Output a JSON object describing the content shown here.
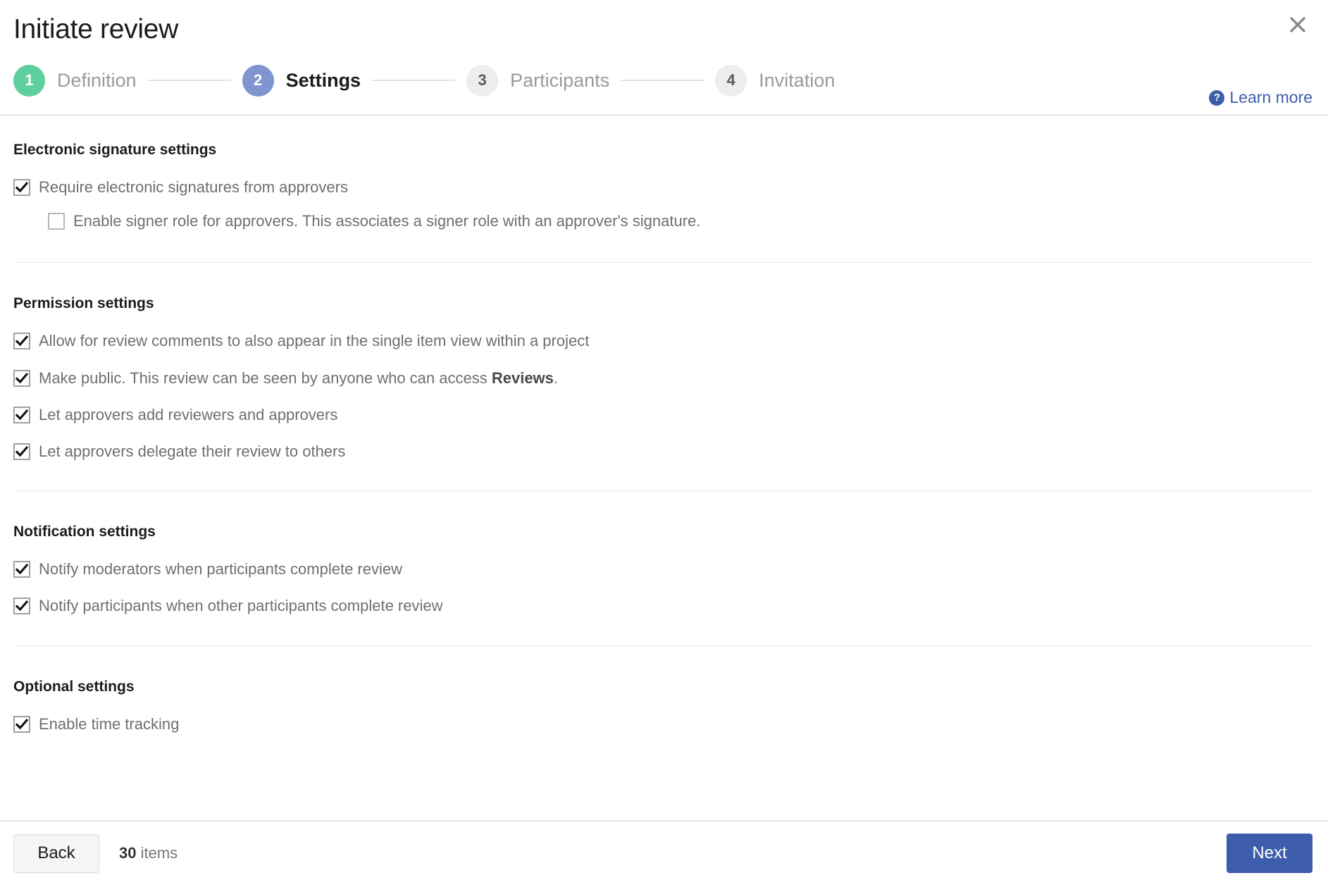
{
  "dialog": {
    "title": "Initiate review",
    "close_icon": "close-icon"
  },
  "stepper": {
    "steps": [
      {
        "number": "1",
        "label": "Definition",
        "state": "done"
      },
      {
        "number": "2",
        "label": "Settings",
        "state": "current"
      },
      {
        "number": "3",
        "label": "Participants",
        "state": "upcoming"
      },
      {
        "number": "4",
        "label": "Invitation",
        "state": "upcoming"
      }
    ],
    "learn_more": {
      "label": "Learn more",
      "icon": "help-circle-icon",
      "color": "#3d5cab"
    }
  },
  "sections": [
    {
      "title": "Electronic signature settings",
      "options": [
        {
          "label": "Require electronic signatures from approvers",
          "checked": true,
          "indented": false
        },
        {
          "label": "Enable signer role for approvers. This associates a signer role with an approver's signature.",
          "checked": false,
          "indented": true
        }
      ]
    },
    {
      "title": "Permission settings",
      "options": [
        {
          "label": "Allow for review comments to also appear in the single item view within a project",
          "checked": true,
          "indented": false
        },
        {
          "label_html": "Make public. This review can be seen by anyone who can access <b>Reviews</b>.",
          "label": "Make public. This review can be seen by anyone who can access Reviews.",
          "checked": true,
          "indented": false
        },
        {
          "label": "Let approvers add reviewers and approvers",
          "checked": true,
          "indented": false
        },
        {
          "label": "Let approvers delegate their review to others",
          "checked": true,
          "indented": false
        }
      ]
    },
    {
      "title": "Notification settings",
      "options": [
        {
          "label": "Notify moderators when participants complete review",
          "checked": true,
          "indented": false
        },
        {
          "label": "Notify participants when other participants complete review",
          "checked": true,
          "indented": false
        }
      ]
    },
    {
      "title": "Optional settings",
      "options": [
        {
          "label": "Enable time tracking",
          "checked": true,
          "indented": false
        }
      ]
    }
  ],
  "footer": {
    "back_label": "Back",
    "count_number": "30",
    "count_unit": "items",
    "next_label": "Next",
    "next_color": "#3d5cab"
  }
}
